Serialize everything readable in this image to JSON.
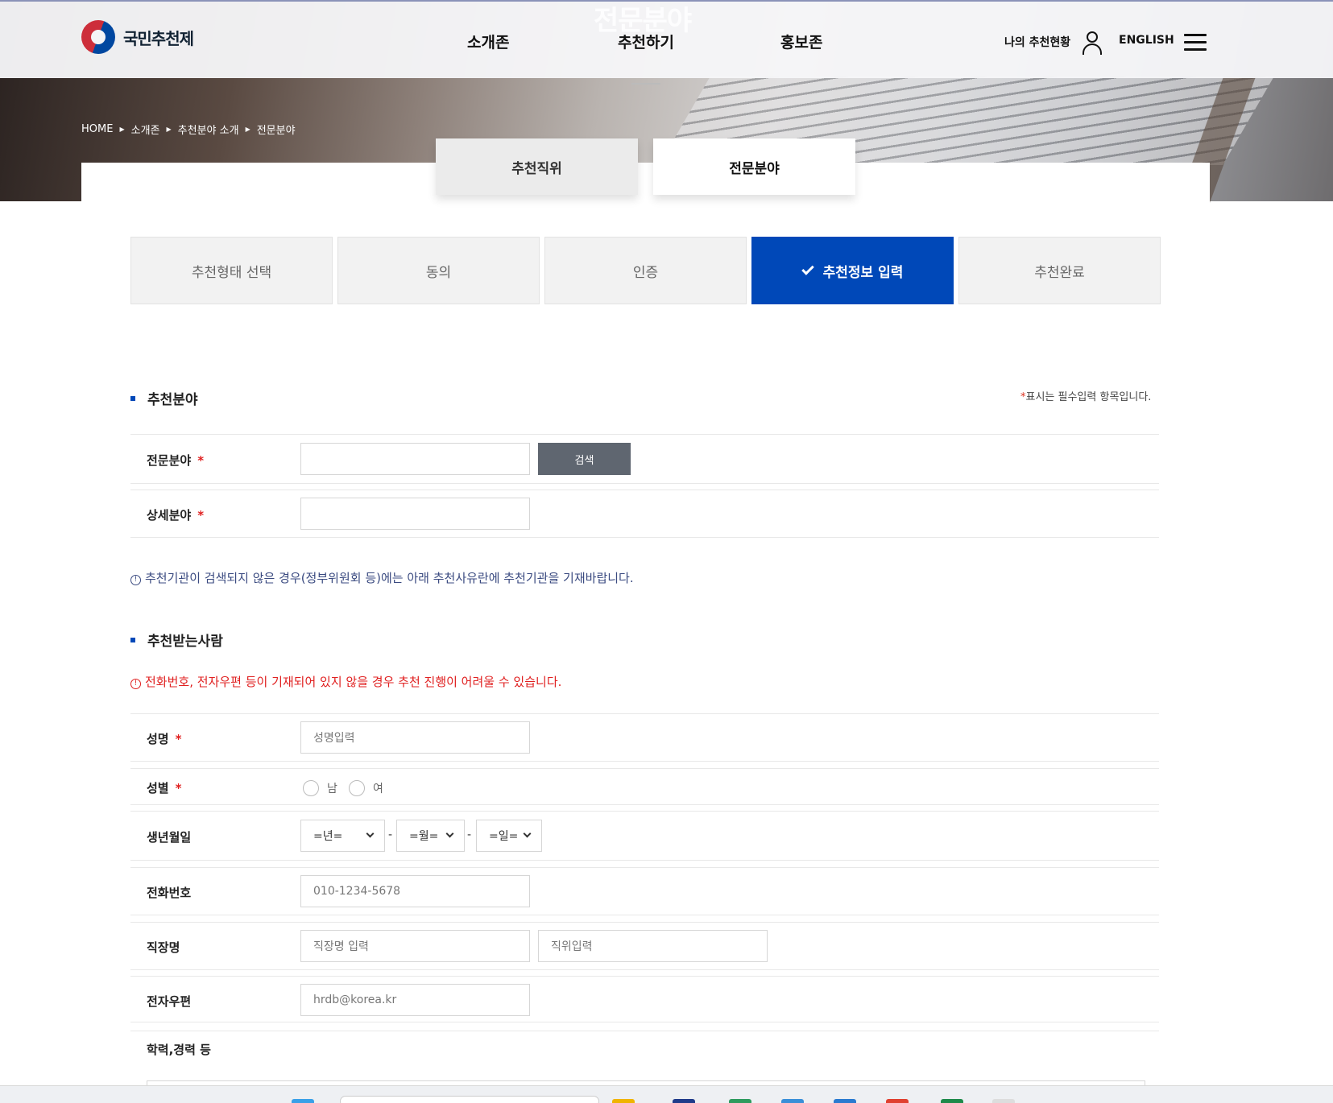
{
  "header": {
    "logo_text": "국민추천제",
    "hero_heading": "전문분야",
    "nav": [
      "소개존",
      "추천하기",
      "홍보존"
    ],
    "my_status": "나의 추천현황",
    "english": "ENGLISH"
  },
  "breadcrumb": [
    "HOME",
    "소개존",
    "추천분야 소개",
    "전문분야"
  ],
  "tabs": [
    {
      "label": "추천직위",
      "active": false
    },
    {
      "label": "전문분야",
      "active": true
    }
  ],
  "steps": [
    {
      "label": "추천형태 선택",
      "active": false
    },
    {
      "label": "동의",
      "active": false
    },
    {
      "label": "인증",
      "active": false
    },
    {
      "label": "추천정보 입력",
      "active": true
    },
    {
      "label": "추천완료",
      "active": false
    }
  ],
  "field_section": {
    "title": "추천분야",
    "required_note_star": "*",
    "required_note": "표시는 필수입력 항목입니다.",
    "specialty_label": "전문분야",
    "search_button": "검색",
    "subfield_label": "상세분야",
    "notice": "추천기관이 검색되지 않은 경우(정부위원회 등)에는 아래 추천사유란에 추천기관을 기재바랍니다."
  },
  "person_section": {
    "title": "추천받는사람",
    "warning": "전화번호, 전자우편 등이 기재되어 있지 않을 경우 추천 진행이 어려울 수 있습니다.",
    "name_label": "성명",
    "name_placeholder": "성명입력",
    "gender_label": "성별",
    "gender_male": "남",
    "gender_female": "여",
    "birth_label": "생년월일",
    "birth_year": "=년=",
    "birth_month": "=월=",
    "birth_day": "=일=",
    "birth_sep": "-",
    "phone_label": "전화번호",
    "phone_placeholder": "010-1234-5678",
    "work_label": "직장명",
    "work_placeholder": "직장명 입력",
    "position_placeholder": "직위입력",
    "email_label": "전자우편",
    "email_placeholder": "hrdb@korea.kr",
    "education_label": "학력,경력 등"
  },
  "required_star": "*",
  "notice_icon": "!",
  "colors": {
    "accent": "#0048b8",
    "required": "#e02020",
    "notice_blue": "#3a4a80",
    "search_button": "#5f6670"
  }
}
